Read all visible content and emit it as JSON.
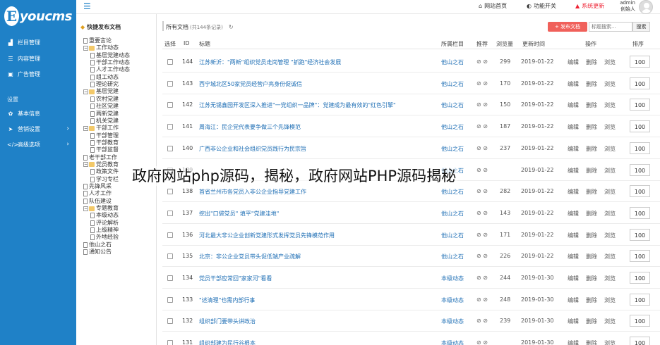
{
  "app": {
    "logo_letter": "E",
    "logo_text": "youcms"
  },
  "sidebar": {
    "items": [
      {
        "label": "栏目管理",
        "icon": "sitemap-icon"
      },
      {
        "label": "内容管理",
        "icon": "list-icon"
      },
      {
        "label": "广告管理",
        "icon": "image-icon"
      }
    ],
    "section": "设置",
    "settings": [
      {
        "label": "基本信息",
        "icon": "gear-icon"
      },
      {
        "label": "营销设置",
        "icon": "send-icon"
      },
      {
        "label": "高级选项",
        "icon": "code-icon"
      }
    ]
  },
  "topbar": {
    "site_home": "网站首页",
    "function_switch": "功能开关",
    "system_update": "系统更新",
    "user_name": "admin",
    "user_role": "创始人"
  },
  "tree": {
    "root": "快捷发布文档",
    "nodes": [
      "重要言论",
      "工作动态",
      "基层党建动态",
      "干部工作动态",
      "人才工作动态",
      "组工动态",
      "理论研究",
      "基层党建",
      "农村党建",
      "社区党建",
      "两新党建",
      "机关党建",
      "干部工作",
      "干部管理",
      "干部教育",
      "干部监督",
      "老干部工作",
      "党员教育",
      "政策文件",
      "学习专栏",
      "先锋风采",
      "人才工作",
      "队伍建设",
      "专题教育",
      "本级动态",
      "评论解析",
      "上级精神",
      "外地经验",
      "他山之石",
      "通知公告"
    ]
  },
  "content": {
    "breadcrumb": "所有文档",
    "record_count": "(共144条记录)",
    "add_label": "+ 发布文档",
    "search_placeholder": "标题搜索...",
    "search_btn": "搜索",
    "columns": {
      "select": "选择",
      "id": "ID",
      "title": "标题",
      "category": "所属栏目",
      "recommend": "推荐",
      "views": "浏览量",
      "updated": "更新时间",
      "ops": "操作",
      "sort": "排序"
    },
    "actions": {
      "edit": "编辑",
      "delete": "删除",
      "browse": "浏览"
    },
    "rows": [
      {
        "id": "144",
        "title": "江苏新沂：\"两新\"组织党员走岗管理 \"抓跑\"经济社会发展",
        "category": "他山之石",
        "flags": "⊘ ⊘",
        "views": "299",
        "date": "2019-01-22",
        "sort": "100"
      },
      {
        "id": "143",
        "title": "西宁城北区50家党员经营户亮身份促诚信",
        "category": "他山之石",
        "flags": "⊘ ⊘",
        "views": "170",
        "date": "2019-01-22",
        "sort": "100"
      },
      {
        "id": "142",
        "title": "江苏无锡鑫园开发区深入推进\"一党组织一品牌\"：党建成为最有效的\"红色引擎\"",
        "category": "他山之石",
        "flags": "⊘ ⊘",
        "views": "150",
        "date": "2019-01-22",
        "sort": "100"
      },
      {
        "id": "141",
        "title": "周海江：民企党代表要争做三个先锋模范",
        "category": "他山之石",
        "flags": "⊘ ⊘",
        "views": "187",
        "date": "2019-01-22",
        "sort": "100"
      },
      {
        "id": "140",
        "title": "广西非公企业和社会组织党员践行为民宗旨",
        "category": "他山之石",
        "flags": "⊘ ⊘",
        "views": "237",
        "date": "2019-01-22",
        "sort": "100"
      },
      {
        "id": "139",
        "title": "",
        "category": "他山之石",
        "flags": "⊘ ⊘",
        "views": "",
        "date": "2019-01-22",
        "sort": "100"
      },
      {
        "id": "138",
        "title": "首省兰州市各党员入非公企业指导党建工作",
        "category": "他山之石",
        "flags": "⊘ ⊘",
        "views": "282",
        "date": "2019-01-22",
        "sort": "100"
      },
      {
        "id": "137",
        "title": "挖出\"口袋党员\" 填平\"党建洼地\"",
        "category": "他山之石",
        "flags": "⊘ ⊘",
        "views": "143",
        "date": "2019-01-22",
        "sort": "100"
      },
      {
        "id": "136",
        "title": "河北最大非公企业创新党建形式发挥党员先锋模范作用",
        "category": "他山之石",
        "flags": "⊘ ⊘",
        "views": "171",
        "date": "2019-01-22",
        "sort": "100"
      },
      {
        "id": "135",
        "title": "北京：非公企业党员带头促低端产业疏解",
        "category": "他山之石",
        "flags": "⊘ ⊘",
        "views": "226",
        "date": "2019-01-22",
        "sort": "100"
      },
      {
        "id": "134",
        "title": "党员干部应常回\"家家河\"看看",
        "category": "本级动态",
        "flags": "⊘ ⊘",
        "views": "244",
        "date": "2019-01-30",
        "sort": "100"
      },
      {
        "id": "133",
        "title": "\"述清理\"也需内部行事",
        "category": "本级动态",
        "flags": "⊘ ⊘",
        "views": "248",
        "date": "2019-01-30",
        "sort": "100"
      },
      {
        "id": "132",
        "title": "组织部门要带头讲政治",
        "category": "本级动态",
        "flags": "⊘ ⊘",
        "views": "239",
        "date": "2019-01-30",
        "sort": "100"
      },
      {
        "id": "131",
        "title": "组织部建为民行谷根本",
        "category": "本级动态",
        "flags": "⊘ ⊘",
        "views": "",
        "date": "2019-01-30",
        "sort": "100"
      }
    ]
  },
  "overlay_text": "政府网站php源码，揭秘，政府网站PHP源码揭秘",
  "colors": {
    "sidebar": "#1f81c7",
    "accent": "#f0605a",
    "link": "#1f6fb5"
  }
}
